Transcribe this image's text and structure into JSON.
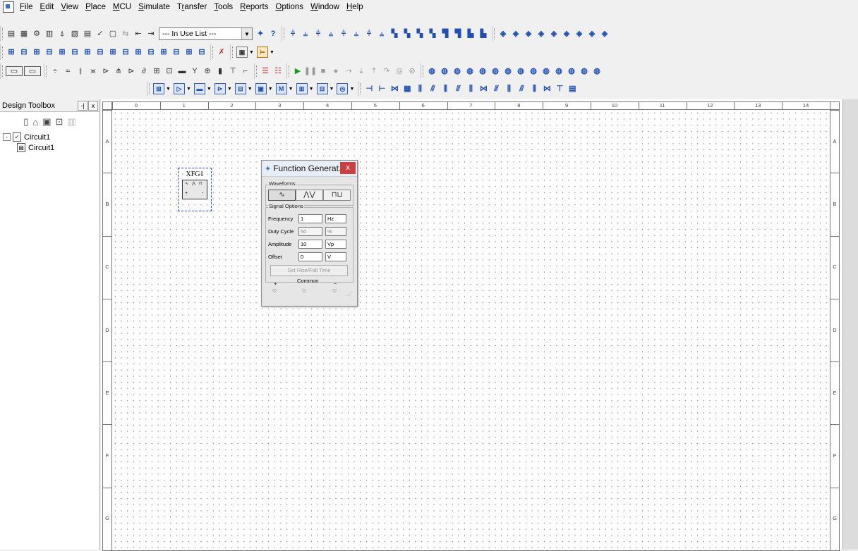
{
  "menubar": {
    "items": [
      "File",
      "Edit",
      "View",
      "Place",
      "MCU",
      "Simulate",
      "Transfer",
      "Tools",
      "Reports",
      "Options",
      "Window",
      "Help"
    ],
    "underlines": [
      "F",
      "E",
      "V",
      "P",
      "M",
      "S",
      "r",
      "T",
      "R",
      "O",
      "W",
      "H"
    ]
  },
  "toolbar": {
    "in_use_list": "--- In Use List ---",
    "help_icon": "?"
  },
  "design_toolbox": {
    "title": "Design Toolbox",
    "pin_label": "-|",
    "close_label": "x",
    "tree": {
      "root": "Circuit1",
      "child": "Circuit1",
      "expand_symbol": "-"
    }
  },
  "sheet": {
    "columns": [
      "0",
      "1",
      "2",
      "3",
      "4",
      "5",
      "6",
      "7",
      "8",
      "9",
      "10",
      "11",
      "12",
      "13",
      "14"
    ],
    "rows": [
      "A",
      "B",
      "C",
      "D",
      "E",
      "F",
      "G"
    ]
  },
  "component": {
    "label": "XFG1",
    "terminals": [
      "+",
      "-"
    ]
  },
  "function_generator": {
    "title": "Function Generat...",
    "close": "x",
    "waveforms_label": "Waveforms",
    "signal_options_label": "Signal Options",
    "frequency": {
      "label": "Frequency",
      "value": "1",
      "unit": "Hz"
    },
    "duty_cycle": {
      "label": "Duty Cycle",
      "value": "50",
      "unit": "%"
    },
    "amplitude": {
      "label": "Amplitude",
      "value": "10",
      "unit": "Vp"
    },
    "offset": {
      "label": "Offset",
      "value": "0",
      "unit": "V"
    },
    "rise_fall_button": "Set Rise/Fall Time",
    "terminal_plus": "+",
    "terminal_common": "Common",
    "terminal_minus": "−"
  }
}
